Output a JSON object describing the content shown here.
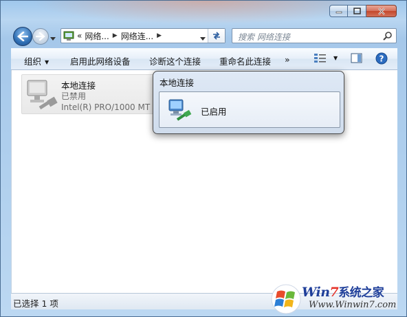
{
  "window": {
    "caption_buttons": [
      "minimize-icon",
      "maximize-icon",
      "close-icon"
    ]
  },
  "navigation": {
    "breadcrumb_prefix": "«",
    "breadcrumb": [
      "网络...",
      "网络连..."
    ],
    "search_placeholder": "搜索 网络连接"
  },
  "toolbar": {
    "organize": "组织",
    "enable_device": "启用此网络设备",
    "diagnose": "诊断这个连接",
    "rename": "重命名此连接",
    "more": "»"
  },
  "connection_item": {
    "name": "本地连接",
    "status": "已禁用",
    "adapter": "Intel(R) PRO/1000 MT N"
  },
  "popup": {
    "title": "本地连接",
    "state": "已启用"
  },
  "status_bar": {
    "text": "已选择 1 项"
  },
  "watermark": {
    "brand_win": "Win",
    "brand_seven": "7",
    "brand_cn": "系统之家",
    "url": "Www.Winwin7.com"
  },
  "colors": {
    "accent": "#2f6fb4",
    "close_button": "#c4472b",
    "disabled_text": "#6b6b6b"
  }
}
